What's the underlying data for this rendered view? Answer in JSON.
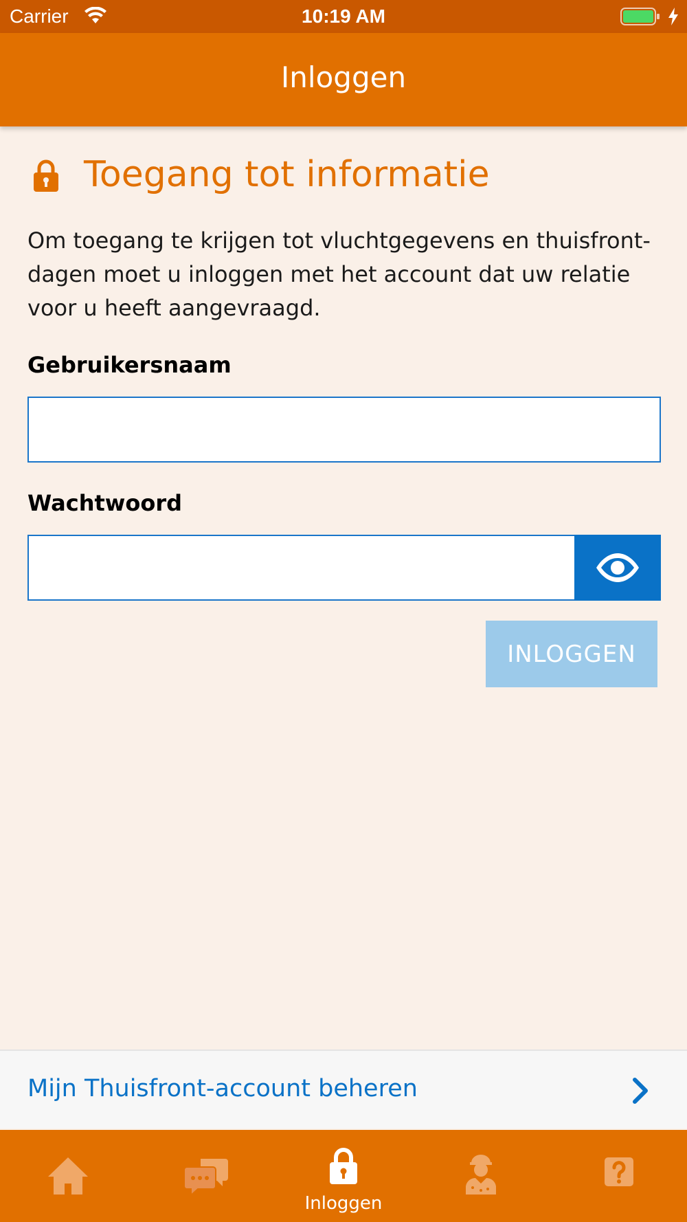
{
  "status_bar": {
    "carrier": "Carrier",
    "time": "10:19 AM",
    "battery_color": "#4cd964"
  },
  "nav": {
    "title": "Inloggen"
  },
  "login": {
    "heading": "Toegang tot informatie",
    "intro": "Om toegang te krijgen tot vluchtgegevens en thuisfront-dagen moet u inloggen met het account dat uw relatie voor u heeft aangevraagd.",
    "username_label": "Gebruikersnaam",
    "username_value": "",
    "password_label": "Wachtwoord",
    "password_value": "",
    "submit_label": "INLOGGEN"
  },
  "manage": {
    "label": "Mijn Thuisfront-account beheren"
  },
  "tabs": [
    {
      "icon": "home-icon",
      "label": ""
    },
    {
      "icon": "chat-icon",
      "label": ""
    },
    {
      "icon": "lock-icon",
      "label": "Inloggen",
      "active": true
    },
    {
      "icon": "soldier-icon",
      "label": ""
    },
    {
      "icon": "help-icon",
      "label": ""
    }
  ],
  "colors": {
    "brand_orange": "#e17000",
    "status_orange": "#c95800",
    "link_blue": "#0a72c7",
    "background": "#faf0e8",
    "disabled_button": "#9ccaea",
    "inactive_tab_icon": "#f0a868"
  }
}
